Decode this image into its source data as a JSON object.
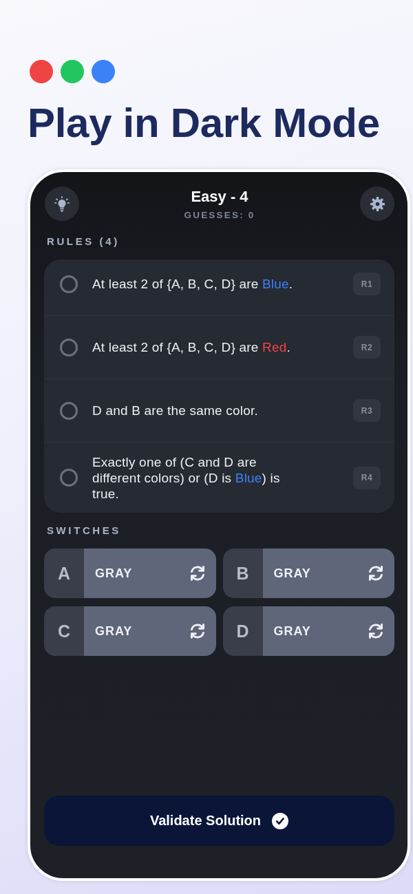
{
  "dots": [
    {
      "color": "#ef4444"
    },
    {
      "color": "#22c55e"
    },
    {
      "color": "#3b82f6"
    }
  ],
  "headline": "Play in Dark Mode",
  "game": {
    "title": "Easy - 4",
    "guesses": "GUESSES: 0"
  },
  "rules_heading": "RULES (4)",
  "rules": [
    {
      "checked": false,
      "segments": [
        {
          "text": "At least 2 of {A, B, C, D} are "
        },
        {
          "text": "Blue",
          "color": "#3b82f6"
        },
        {
          "text": "."
        }
      ],
      "tag": "R1"
    },
    {
      "checked": false,
      "segments": [
        {
          "text": "At least 2 of {A, B, C, D} are "
        },
        {
          "text": "Red",
          "color": "#ef4444"
        },
        {
          "text": "."
        }
      ],
      "tag": "R2"
    },
    {
      "checked": false,
      "segments": [
        {
          "text": "D and B are the same color."
        }
      ],
      "tag": "R3"
    },
    {
      "checked": false,
      "segments": [
        {
          "text": "Exactly one of (C and D are different colors) or (D is "
        },
        {
          "text": "Blue",
          "color": "#3b82f6"
        },
        {
          "text": ") is true."
        }
      ],
      "tag": "R4"
    }
  ],
  "switches_heading": "SWITCHES",
  "switches": [
    {
      "letter": "A",
      "value": "GRAY",
      "color": "#5f6679"
    },
    {
      "letter": "B",
      "value": "GRAY",
      "color": "#5f6679"
    },
    {
      "letter": "C",
      "value": "GRAY",
      "color": "#5f6679"
    },
    {
      "letter": "D",
      "value": "GRAY",
      "color": "#5f6679"
    }
  ],
  "validate_button": {
    "label": "Validate Solution"
  }
}
